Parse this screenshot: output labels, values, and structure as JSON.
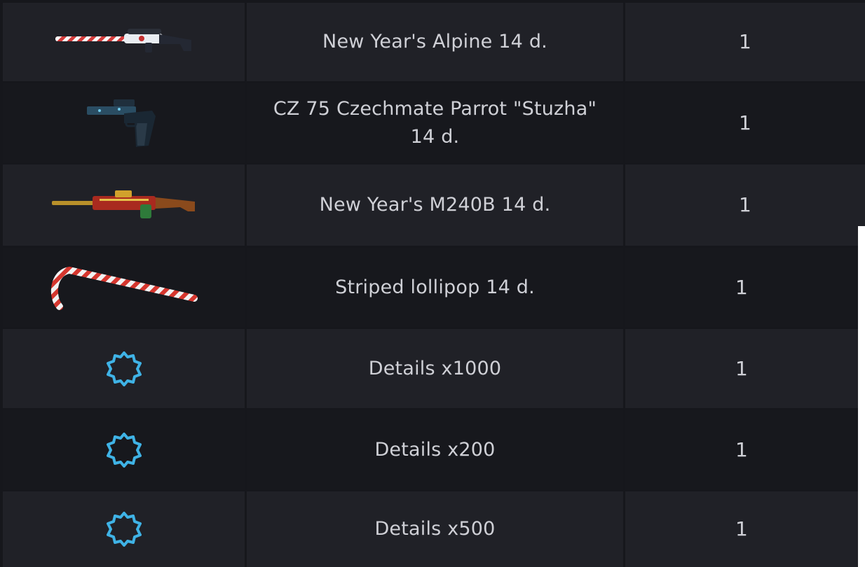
{
  "rows": [
    {
      "name": "New Year's Alpine 14 d.",
      "qty": "1",
      "icon": "candy-cane-sniper-rifle-icon"
    },
    {
      "name": "CZ 75 Czechmate Parrot \"Stuzha\" 14 d.",
      "qty": "1",
      "icon": "frost-pistol-icon"
    },
    {
      "name": "New Year's M240B 14 d.",
      "qty": "1",
      "icon": "gift-wrap-machine-gun-icon"
    },
    {
      "name": "Striped lollipop 14 d.",
      "qty": "1",
      "icon": "candy-cane-icon"
    },
    {
      "name": "Details x1000",
      "qty": "1",
      "icon": "gear-details-icon"
    },
    {
      "name": "Details x200",
      "qty": "1",
      "icon": "gear-details-icon"
    },
    {
      "name": "Details x500",
      "qty": "1",
      "icon": "gear-details-icon"
    }
  ],
  "colors": {
    "row_light": "#202127",
    "row_dark": "#17181d",
    "text": "#cfd0d6",
    "gear_icon": "#3fb3e6"
  }
}
